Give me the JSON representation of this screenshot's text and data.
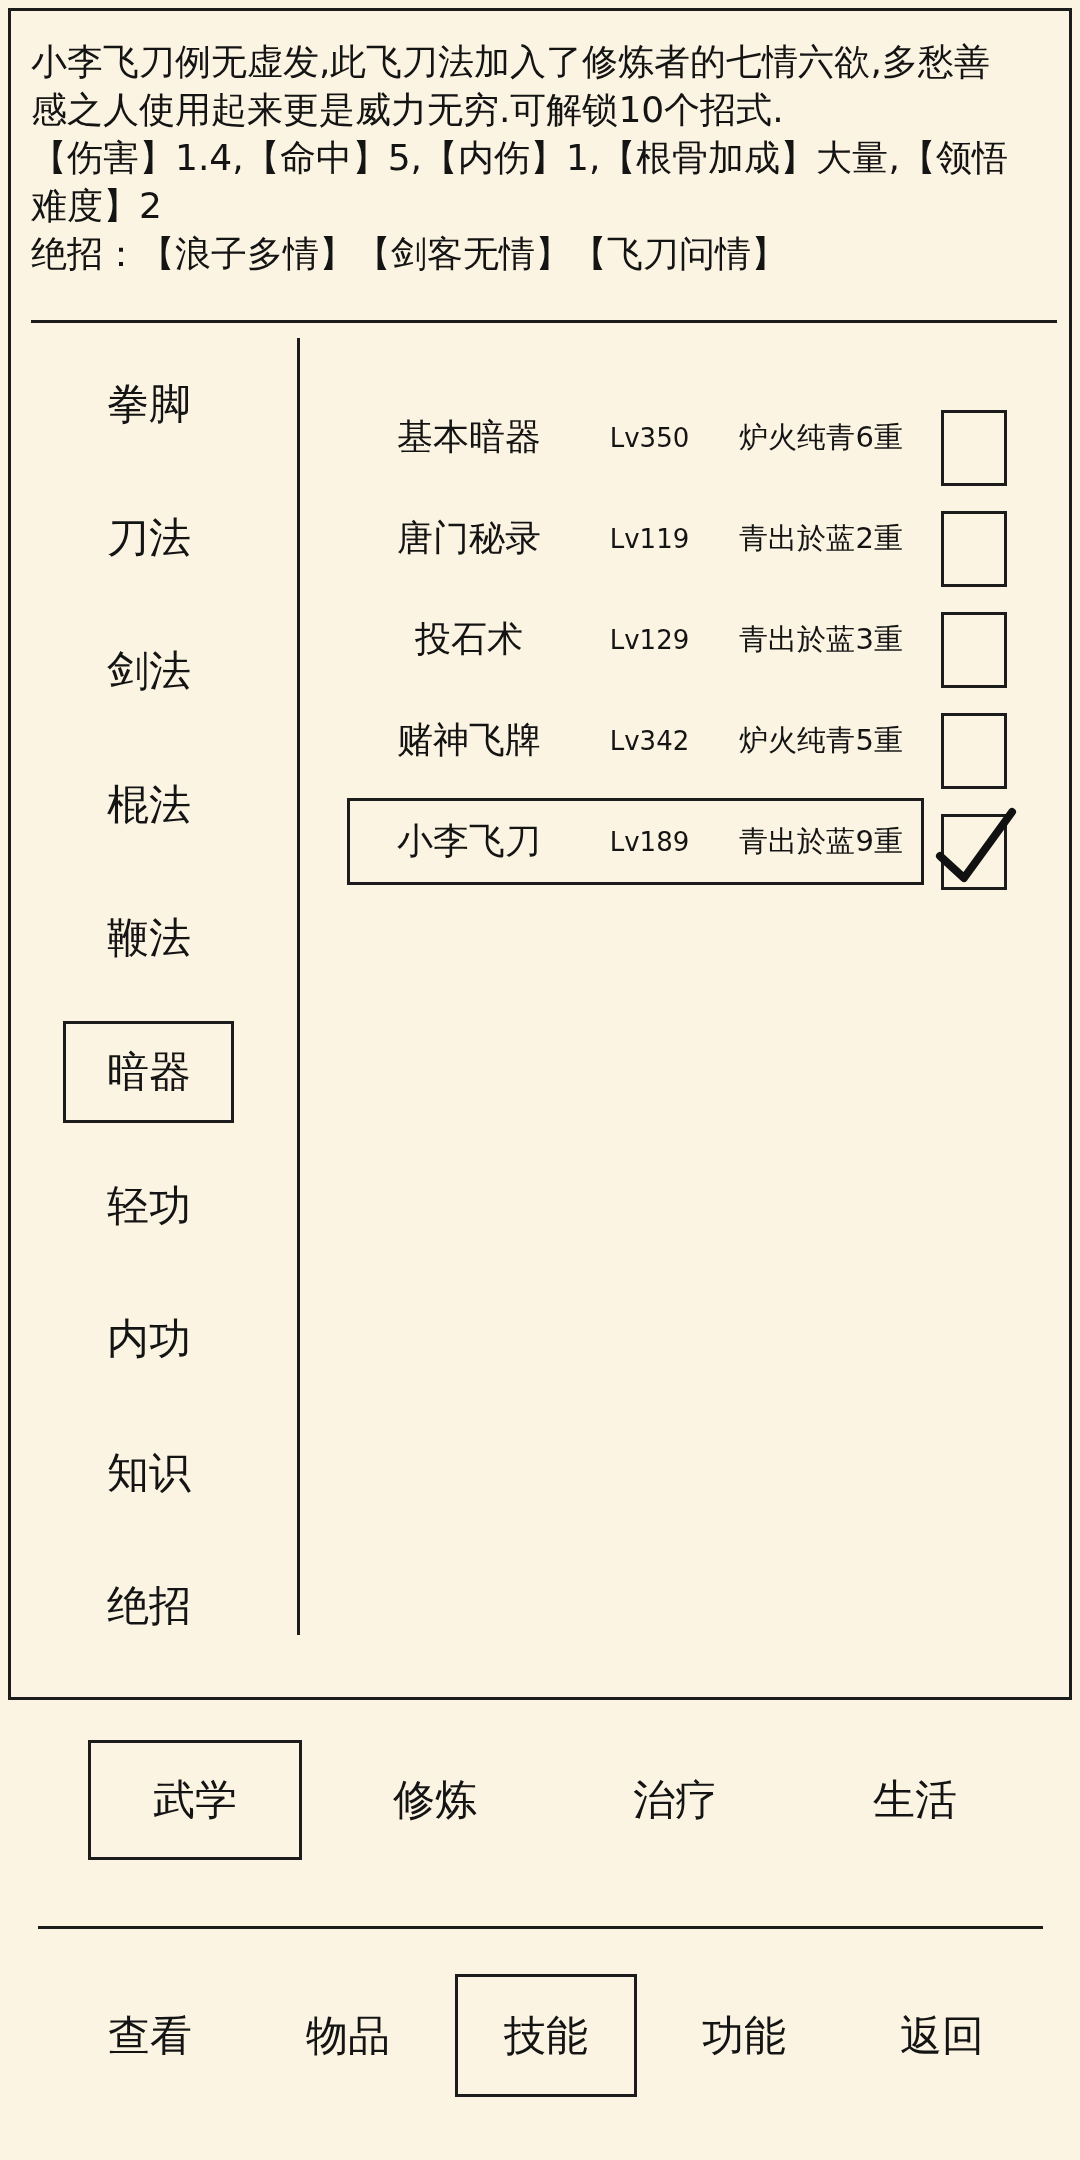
{
  "description": {
    "paragraphs": [
      "小李飞刀例无虚发,此飞刀法加入了修炼者的七情六欲,多愁善感之人使用起来更是威力无穷.可解锁10个招式.",
      "【伤害】1.4,【命中】5,【内伤】1,【根骨加成】大量,【领悟难度】2",
      "绝招：【浪子多情】【剑客无情】【飞刀问情】"
    ]
  },
  "categories": [
    {
      "label": "拳脚",
      "selected": false
    },
    {
      "label": "刀法",
      "selected": false
    },
    {
      "label": "剑法",
      "selected": false
    },
    {
      "label": "棍法",
      "selected": false
    },
    {
      "label": "鞭法",
      "selected": false
    },
    {
      "label": "暗器",
      "selected": true
    },
    {
      "label": "轻功",
      "selected": false
    },
    {
      "label": "内功",
      "selected": false
    },
    {
      "label": "知识",
      "selected": false
    },
    {
      "label": "绝招",
      "selected": false
    }
  ],
  "skills": [
    {
      "name": "基本暗器",
      "lv": "Lv350",
      "grade": "炉火纯青6重",
      "selected": false,
      "checked": false
    },
    {
      "name": "唐门秘录",
      "lv": "Lv119",
      "grade": "青出於蓝2重",
      "selected": false,
      "checked": false
    },
    {
      "name": "投石术",
      "lv": "Lv129",
      "grade": "青出於蓝3重",
      "selected": false,
      "checked": false
    },
    {
      "name": "赌神飞牌",
      "lv": "Lv342",
      "grade": "炉火纯青5重",
      "selected": false,
      "checked": false
    },
    {
      "name": "小李飞刀",
      "lv": "Lv189",
      "grade": "青出於蓝9重",
      "selected": true,
      "checked": true
    }
  ],
  "tabs": [
    {
      "label": "武学",
      "selected": true
    },
    {
      "label": "修炼",
      "selected": false
    },
    {
      "label": "治疗",
      "selected": false
    },
    {
      "label": "生活",
      "selected": false
    }
  ],
  "nav": [
    {
      "label": "查看",
      "selected": false
    },
    {
      "label": "物品",
      "selected": false
    },
    {
      "label": "技能",
      "selected": true
    },
    {
      "label": "功能",
      "selected": false
    },
    {
      "label": "返回",
      "selected": false
    }
  ]
}
